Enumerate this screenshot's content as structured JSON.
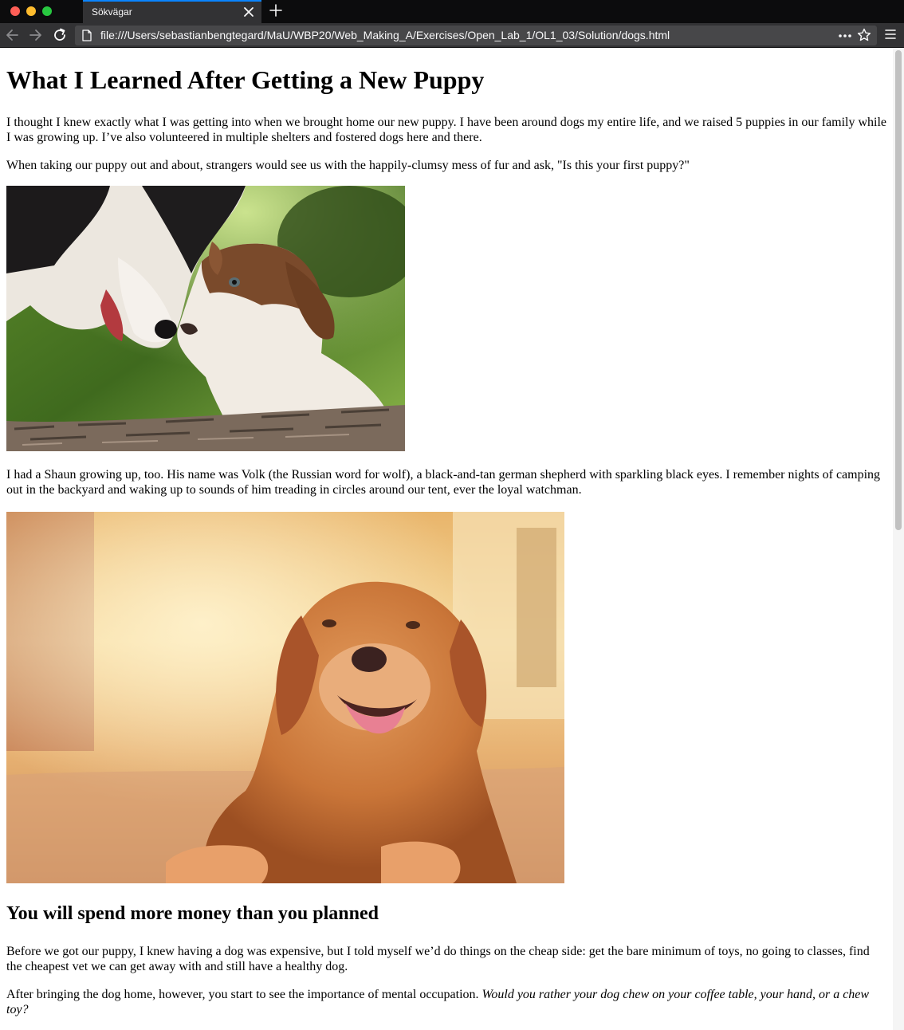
{
  "browser": {
    "tab_title": "Sökvägar",
    "url": "file:///Users/sebastianbengtegard/MaU/WBP20/Web_Making_A/Exercises/Open_Lab_1/OL1_03/Solution/dogs.html"
  },
  "article": {
    "title": "What I Learned After Getting a New Puppy",
    "p1": "I thought I knew exactly what I was getting into when we brought home our new puppy. I have been around dogs my entire life, and we raised 5 puppies in our family while I was growing up. I’ve also volunteered in multiple shelters and fostered dogs here and there.",
    "p2": "When taking our puppy out and about, strangers would see us with the happily-clumsy mess of fur and ask, \"Is this your first puppy?\"",
    "p3": "I had a Shaun growing up, too. His name was Volk (the Russian word for wolf), a black-and-tan german shepherd with sparkling black eyes. I remember nights of camping out in the backyard and waking up to sounds of him treading in circles around our tent, ever the loyal watchman.",
    "h2": "You will spend more money than you planned",
    "p4": "Before we got our puppy, I knew having a dog was expensive, but I told myself we’d do things on the cheap side: get the bare minimum of toys, no going to classes, find the cheapest vet we can get away with and still have a healthy dog.",
    "p5_plain": "After bringing the dog home, however, you start to see the importance of mental occupation. ",
    "p5_italic": "Would you rather your dog chew on your coffee table, your hand, or a chew toy?"
  },
  "colors": {
    "titlebar": "#0c0c0d",
    "toolbar": "#323234",
    "urlbar": "#474749",
    "tab_accent": "#0a84ff"
  }
}
